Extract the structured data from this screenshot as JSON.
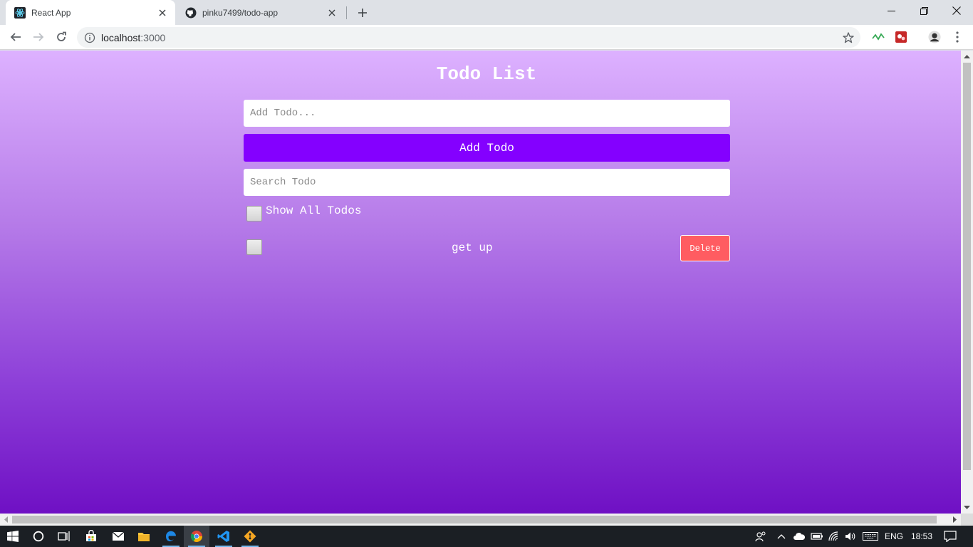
{
  "browser": {
    "tabs": [
      {
        "title": "React App",
        "active": true,
        "icon": "react-icon"
      },
      {
        "title": "pinku7499/todo-app",
        "active": false,
        "icon": "github-icon"
      }
    ],
    "address": {
      "host": "localhost",
      "port": ":3000"
    }
  },
  "page": {
    "title": "Todo List",
    "add_input": {
      "placeholder": "Add Todo...",
      "value": ""
    },
    "add_button_label": "Add Todo",
    "search_input": {
      "placeholder": "Search Todo",
      "value": ""
    },
    "show_all": {
      "label": "Show All Todos",
      "checked": false
    },
    "todos": [
      {
        "text": "get up",
        "completed": false,
        "delete_label": "Delete"
      }
    ],
    "colors": {
      "accent": "#8400ff",
      "delete": "#ff5c61",
      "gradient_top": "#ddb1ff",
      "gradient_bottom": "#6f10c4"
    }
  },
  "taskbar": {
    "apps": [
      "windows-start-icon",
      "cortana-icon",
      "task-view-icon",
      "store-icon",
      "mail-icon",
      "file-explorer-icon",
      "edge-icon",
      "chrome-icon",
      "vscode-icon",
      "git-icon"
    ],
    "language": "ENG",
    "time": "18:53"
  }
}
